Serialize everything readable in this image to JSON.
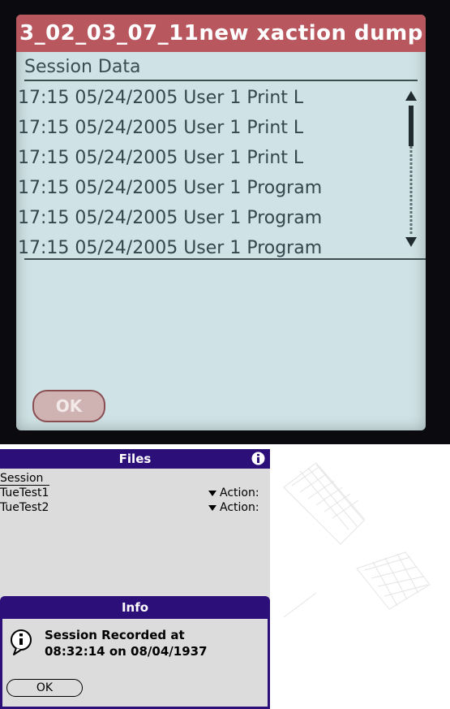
{
  "device_photo": {
    "title": "3_02_03_07_11new xaction dump",
    "section": "Session Data",
    "rows": [
      "17:15 05/24/2005 User 1 Print L",
      "17:15 05/24/2005 User 1 Print L",
      "17:15 05/24/2005 User 1 Print L",
      "17:15 05/24/2005 User 1 Program",
      "17:15 05/24/2005 User 1 Program",
      "17:15 05/24/2005 User 1 Program"
    ],
    "ok_label": "OK"
  },
  "palm": {
    "title": "Files",
    "info_icon": "info-icon",
    "section": "Session",
    "files": [
      {
        "name": "TueTest1",
        "action": "Action:"
      },
      {
        "name": "TueTest2",
        "action": "Action:"
      }
    ],
    "dialog": {
      "title": "Info",
      "icon": "info-icon",
      "message_line1": "Session Recorded at",
      "message_line2": "08:32:14 on 08/04/1937",
      "ok_label": "OK"
    }
  },
  "colors": {
    "palm_titlebar": "#2d0f7a",
    "device_titlebar": "#b9575f",
    "device_screen": "#cfe2e5"
  }
}
